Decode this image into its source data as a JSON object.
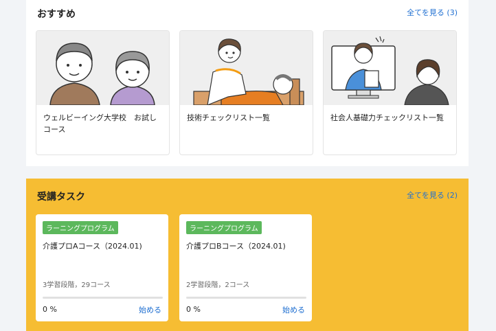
{
  "recommended": {
    "title": "おすすめ",
    "see_all": "全てを見る (3)",
    "items": [
      {
        "title": "ウェルビーイング大学校　お試しコース",
        "thumb_icon": "couple-illustration-icon"
      },
      {
        "title": "技術チェックリスト一覧",
        "thumb_icon": "caregiver-illustration-icon"
      },
      {
        "title": "社会人基礎力チェックリスト一覧",
        "thumb_icon": "online-lecture-illustration-icon"
      }
    ]
  },
  "tasks": {
    "title": "受講タスク",
    "see_all": "全てを見る (2)",
    "items": [
      {
        "badge": "ラーニングプログラム",
        "title": "介護プロAコース（2024.01)",
        "meta": "3学習段階，29コース",
        "progress": "0 %",
        "progress_value": 0,
        "action": "始める"
      },
      {
        "badge": "ラーニングプログラム",
        "title": "介護プロBコース（2024.01)",
        "meta": "2学習段階，2コース",
        "progress": "0 %",
        "progress_value": 0,
        "action": "始める"
      }
    ]
  },
  "colors": {
    "accent": "#1f6fd1",
    "task_bg": "#f6bd33",
    "badge": "#5cb85c"
  }
}
